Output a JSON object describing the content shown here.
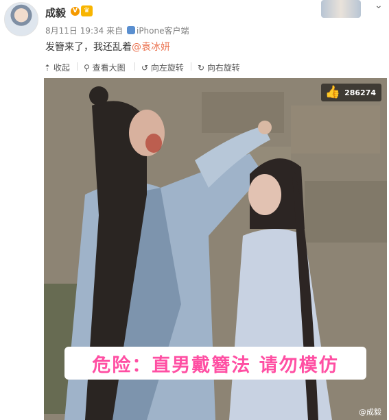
{
  "post": {
    "author": "成毅",
    "badge_v": "V",
    "badge_crown": "♛",
    "date": "8月11日 19:34",
    "from_prefix": "来自",
    "device": "iPhone客户端",
    "text": "发簪来了，我还乱着",
    "mention": "@袁冰妍"
  },
  "toolbar": {
    "collapse": "收起",
    "view_large": "查看大图",
    "rotate_left": "向左旋转",
    "rotate_right": "向右旋转"
  },
  "image": {
    "likes": "286274",
    "caption": "危险：直男戴簪法 请勿模仿",
    "watermark": "@成毅"
  },
  "colors": {
    "mention": "#eb7350",
    "caption": "#ff4fa3"
  }
}
